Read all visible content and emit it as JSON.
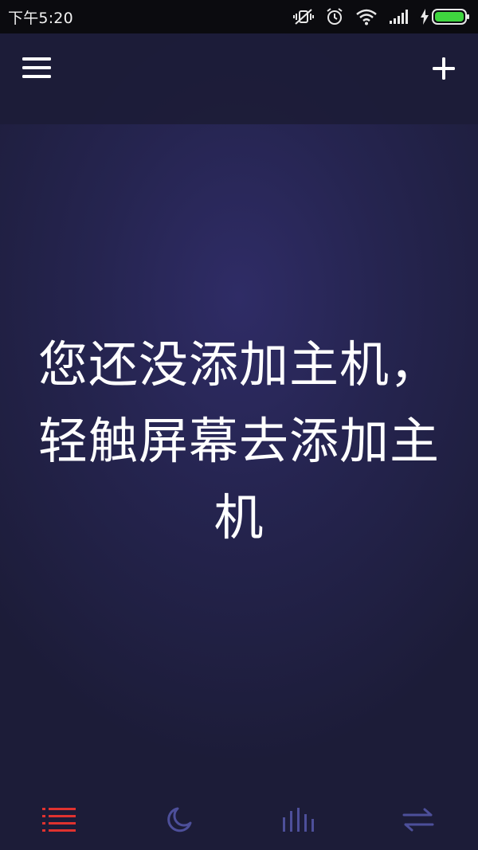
{
  "status_bar": {
    "time": "下午5:20",
    "icons": [
      "mute-vibrate-icon",
      "alarm-icon",
      "wifi-icon",
      "signal-icon",
      "charging-icon",
      "battery-icon"
    ],
    "battery_color": "#3fd63f"
  },
  "app_bar": {
    "menu_icon": "menu-icon",
    "add_icon": "plus-icon"
  },
  "empty_state": {
    "message": "您还没添加主机，轻触屏幕去添加主机"
  },
  "bottom_nav": {
    "items": [
      {
        "icon": "list-icon",
        "active": true,
        "color": "#e0322f"
      },
      {
        "icon": "moon-icon",
        "active": false,
        "color": "#4d4f9a"
      },
      {
        "icon": "bars-icon",
        "active": false,
        "color": "#4d4f9a"
      },
      {
        "icon": "swap-arrows-icon",
        "active": false,
        "color": "#4d4f9a"
      }
    ]
  }
}
